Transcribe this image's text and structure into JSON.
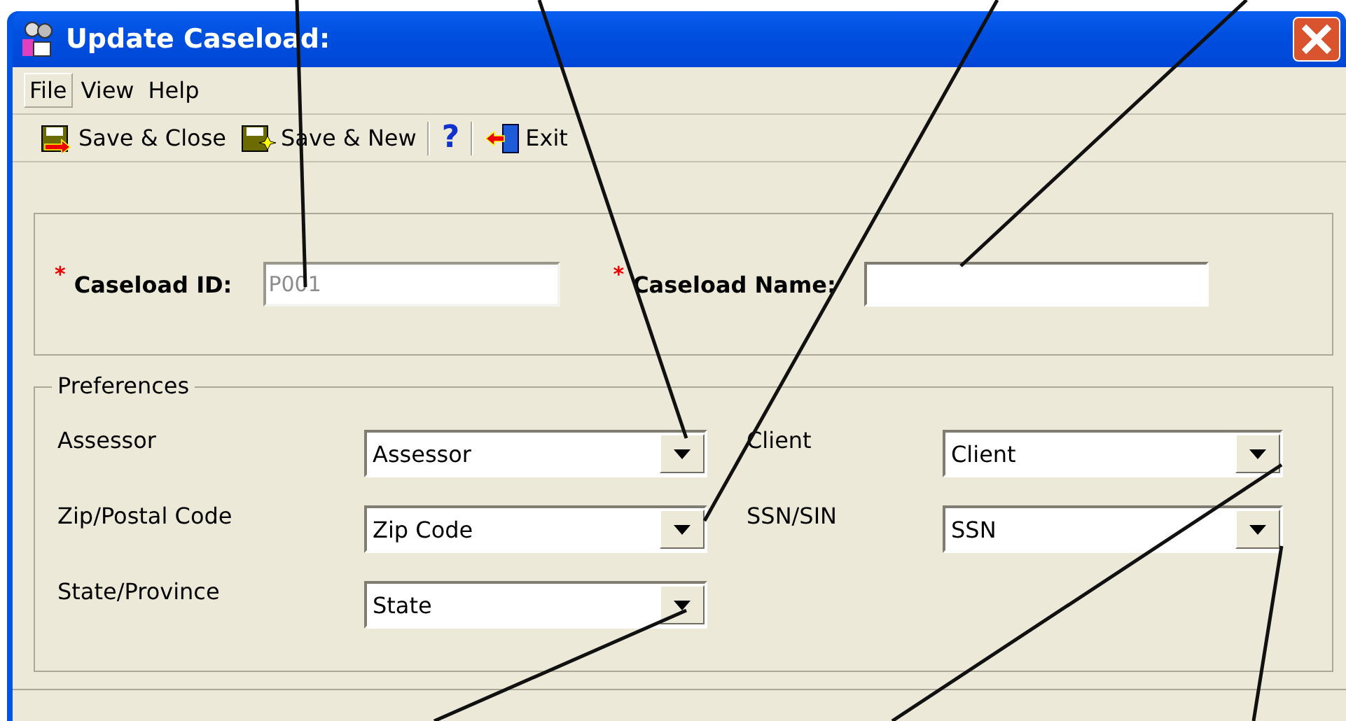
{
  "window": {
    "title": "Update Caseload:"
  },
  "menu": [
    {
      "label": "File",
      "selected": true
    },
    {
      "label": "View",
      "selected": false
    },
    {
      "label": "Help",
      "selected": false
    }
  ],
  "toolbar": [
    {
      "kind": "save-close",
      "label": "Save & Close"
    },
    {
      "kind": "save-new",
      "label": "Save & New"
    },
    {
      "kind": "separator"
    },
    {
      "kind": "help",
      "label": "?"
    },
    {
      "kind": "separator"
    },
    {
      "kind": "exit",
      "label": "Exit"
    }
  ],
  "caseload": {
    "id": {
      "required_mark": "*",
      "label": "Caseload ID:",
      "value": "P001",
      "disabled": true
    },
    "name": {
      "required_mark": "*",
      "label": "Caseload Name:"
    }
  },
  "preferences": {
    "title": "Preferences",
    "left": [
      {
        "label": "Assessor",
        "value": "Assessor"
      },
      {
        "label": "Zip/Postal Code",
        "value": "Zip Code"
      },
      {
        "label": "State/Province",
        "value": "State"
      }
    ],
    "right": [
      {
        "label": "Client",
        "value": "Client"
      },
      {
        "label": "SSN/SIN",
        "value": "SSN"
      }
    ]
  }
}
